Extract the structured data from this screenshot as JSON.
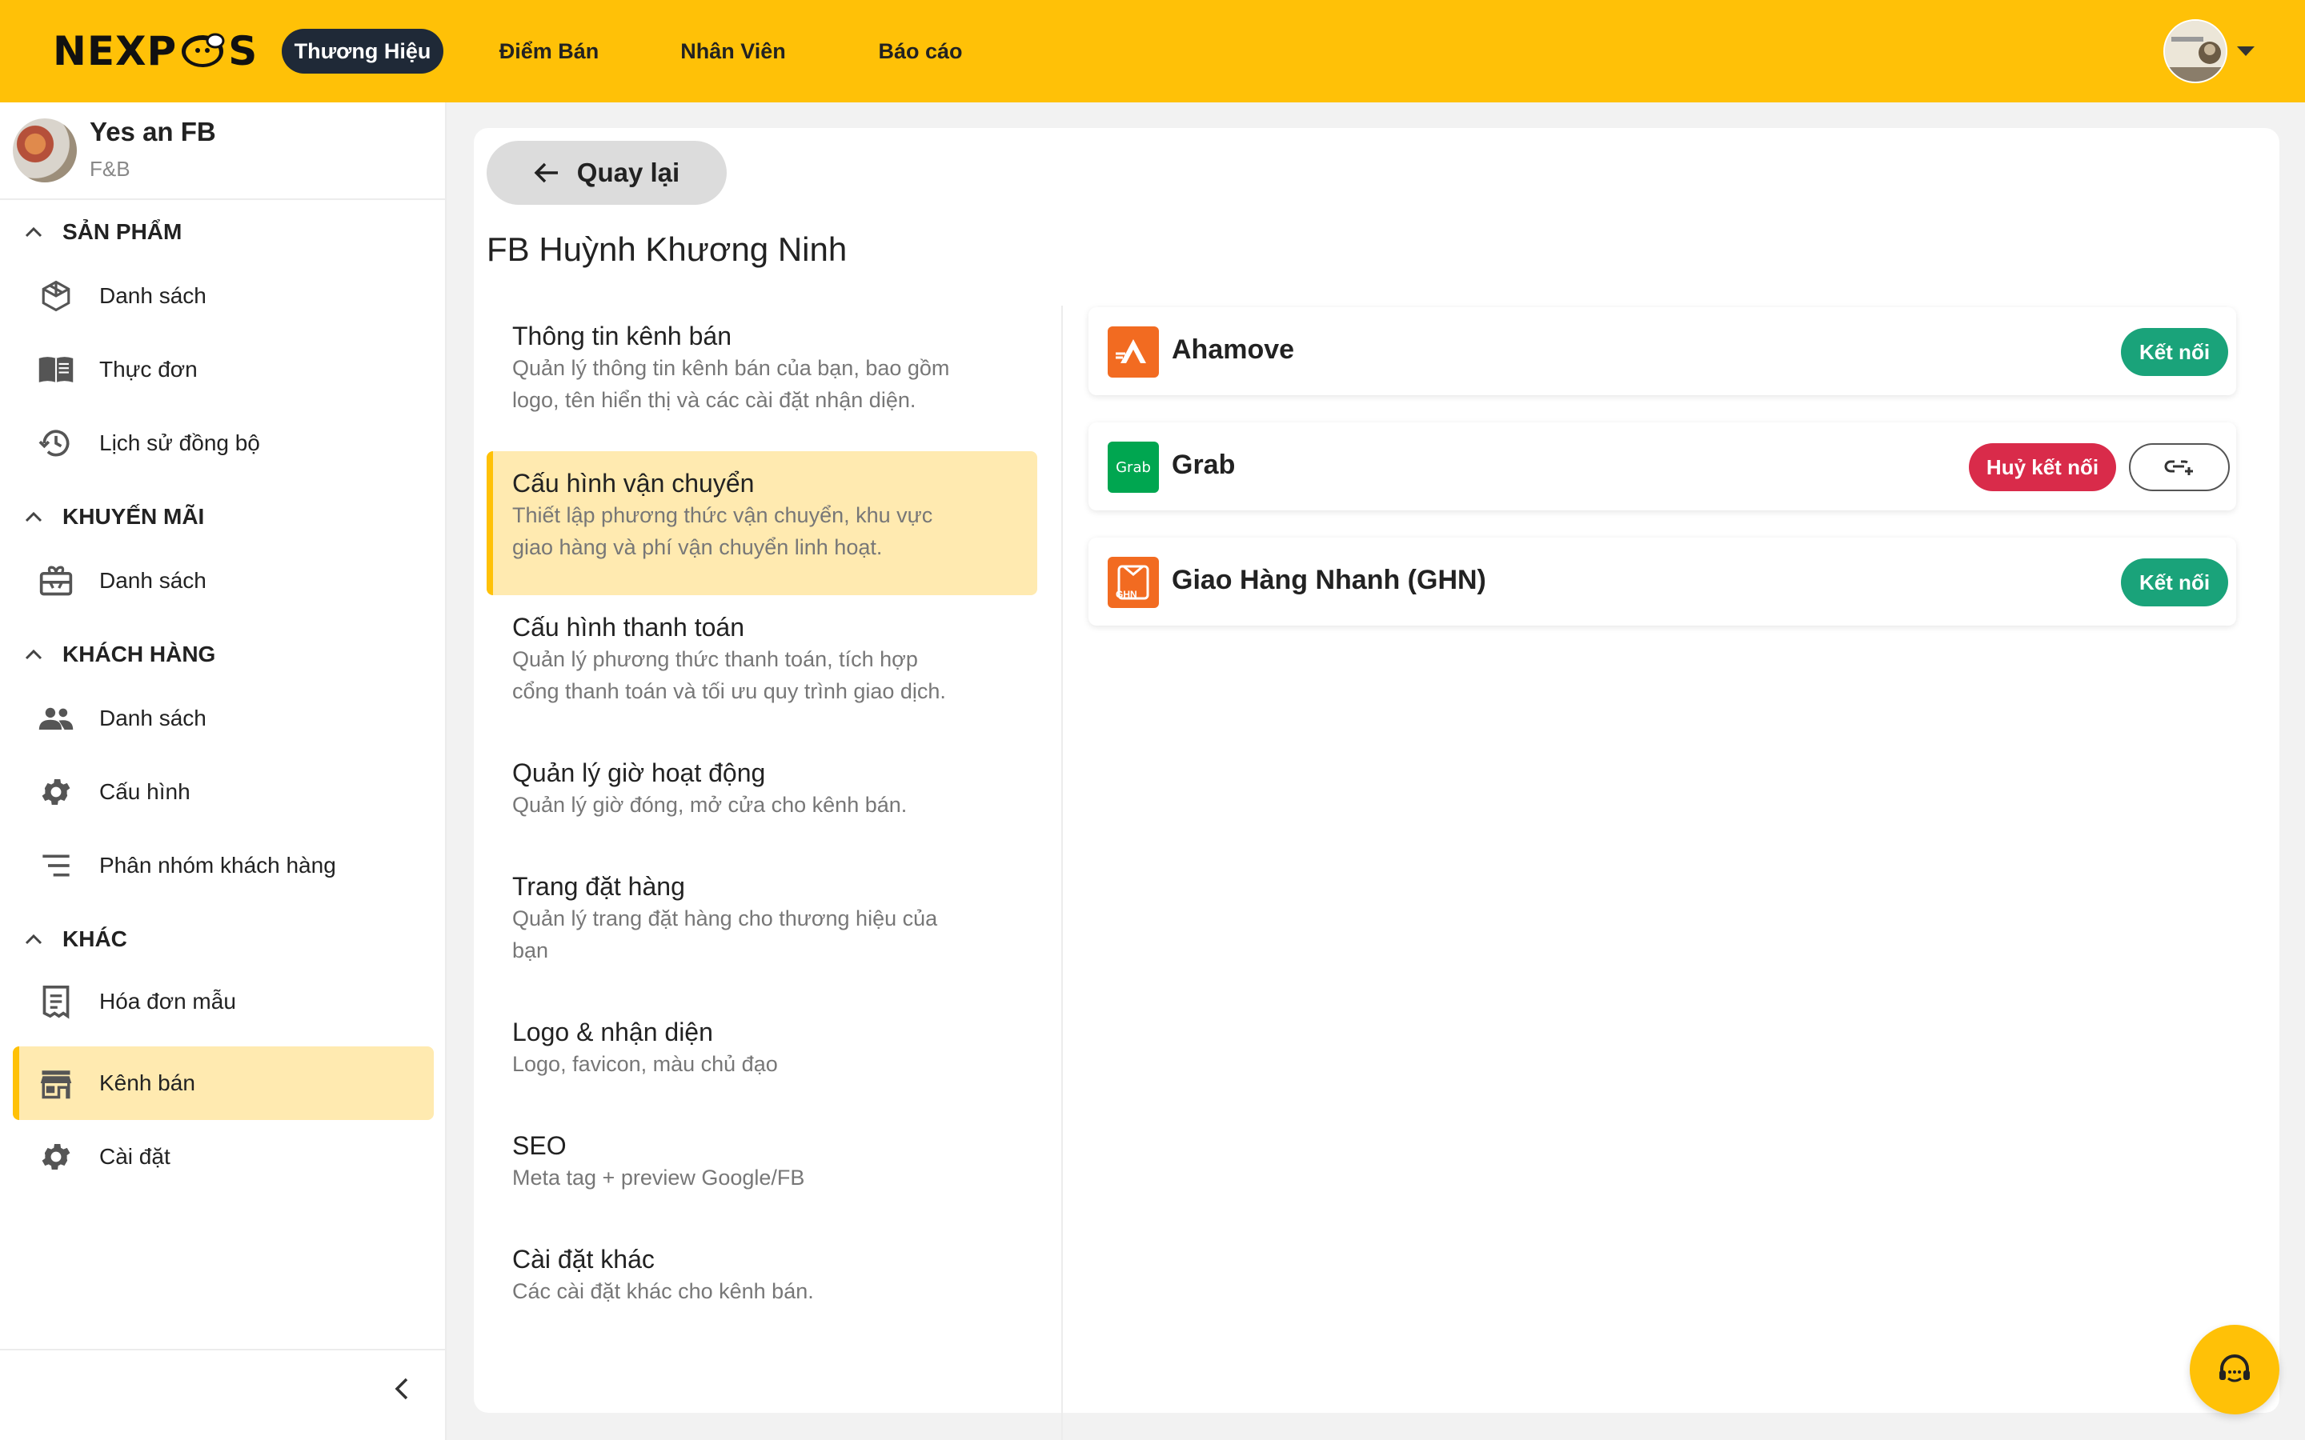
{
  "topbar": {
    "logo_text": "NEXPOS",
    "nav": [
      {
        "label": "Thương Hiệu",
        "active": true
      },
      {
        "label": "Điểm Bán",
        "active": false
      },
      {
        "label": "Nhân Viên",
        "active": false
      },
      {
        "label": "Báo cáo",
        "active": false
      }
    ],
    "accent_color": "#ffc107"
  },
  "sidebar": {
    "brand_name": "Yes an FB",
    "brand_type": "F&B",
    "sections": [
      {
        "title": "SẢN PHẨM",
        "items": [
          {
            "label": "Danh sách",
            "icon": "cube-icon"
          },
          {
            "label": "Thực đơn",
            "icon": "menu-book-icon"
          },
          {
            "label": "Lịch sử đồng bộ",
            "icon": "history-icon"
          }
        ]
      },
      {
        "title": "KHUYẾN MÃI",
        "items": [
          {
            "label": "Danh sách",
            "icon": "gift-card-icon"
          }
        ]
      },
      {
        "title": "KHÁCH HÀNG",
        "items": [
          {
            "label": "Danh sách",
            "icon": "people-icon"
          },
          {
            "label": "Cấu hình",
            "icon": "gear-icon"
          },
          {
            "label": "Phân nhóm khách hàng",
            "icon": "sort-lines-icon"
          }
        ]
      },
      {
        "title": "KHÁC",
        "items": [
          {
            "label": "Hóa đơn mẫu",
            "icon": "receipt-icon"
          },
          {
            "label": "Kênh bán",
            "icon": "store-icon",
            "active": true
          },
          {
            "label": "Cài đặt",
            "icon": "gear-icon"
          }
        ]
      }
    ]
  },
  "main": {
    "back_label": "Quay lại",
    "channel_title": "FB Huỳnh Khương Ninh",
    "menu": [
      {
        "title": "Thông tin kênh bán",
        "desc": [
          "Quản lý thông tin kênh bán của bạn, bao gồm",
          "logo, tên hiển thị và các cài đặt nhận diện."
        ]
      },
      {
        "title": "Cấu hình vận chuyển",
        "desc": [
          "Thiết lập phương thức vận chuyển, khu vực",
          "giao hàng và phí vận chuyển linh hoạt."
        ],
        "active": true
      },
      {
        "title": "Cấu hình thanh toán",
        "desc": [
          "Quản lý phương thức thanh toán, tích hợp",
          "cổng thanh toán và tối ưu quy trình giao dịch."
        ]
      },
      {
        "title": "Quản lý giờ hoạt động",
        "desc": [
          "Quản lý giờ đóng, mở cửa cho kênh bán."
        ]
      },
      {
        "title": "Trang đặt hàng",
        "desc": [
          "Quản lý trang đặt hàng cho thương hiệu của",
          "bạn"
        ]
      },
      {
        "title": "Logo & nhận diện",
        "desc": [
          "Logo, favicon, màu chủ đạo"
        ]
      },
      {
        "title": "SEO",
        "desc": [
          "Meta tag + preview Google/FB"
        ]
      },
      {
        "title": "Cài đặt khác",
        "desc": [
          "Các cài đặt khác cho kênh bán."
        ]
      }
    ],
    "carriers": [
      {
        "name": "Ahamove",
        "logo_color": "#f26b21",
        "action": "Kết nối",
        "connected": false
      },
      {
        "name": "Grab",
        "logo_color": "#00a650",
        "logo_text": "Grab",
        "action": "Huỷ kết nối",
        "connected": true
      },
      {
        "name": "Giao Hàng Nhanh (GHN)",
        "logo_color": "#f26b21",
        "logo_text": "GHN",
        "action": "Kết nối",
        "connected": false
      }
    ],
    "colors": {
      "connect": "#1aa37a",
      "disconnect": "#d92b4a",
      "active_bg": "#ffeab0"
    }
  }
}
